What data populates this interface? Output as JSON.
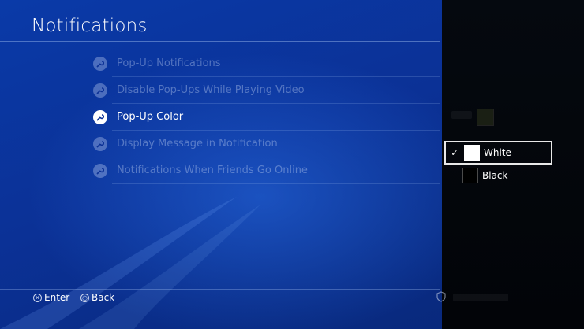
{
  "header": {
    "title": "Notifications"
  },
  "menu": {
    "items": [
      {
        "label": "Pop-Up Notifications",
        "active": false
      },
      {
        "label": "Disable Pop-Ups While Playing Video",
        "active": false
      },
      {
        "label": "Pop-Up Color",
        "active": true
      },
      {
        "label": "Display Message in Notification",
        "active": false
      },
      {
        "label": "Notifications When Friends Go Online",
        "active": false
      }
    ]
  },
  "color_options": {
    "selected": "White",
    "items": [
      {
        "label": "White",
        "swatch": "#ffffff"
      },
      {
        "label": "Black",
        "swatch": "#000000"
      }
    ],
    "check_glyph": "✓"
  },
  "footer": {
    "enter_label": "Enter",
    "back_label": "Back",
    "enter_glyph": "✕",
    "back_glyph": "○"
  },
  "colors": {
    "background": "#0b3196",
    "panel": "#03060b",
    "text_active": "#ffffff"
  }
}
